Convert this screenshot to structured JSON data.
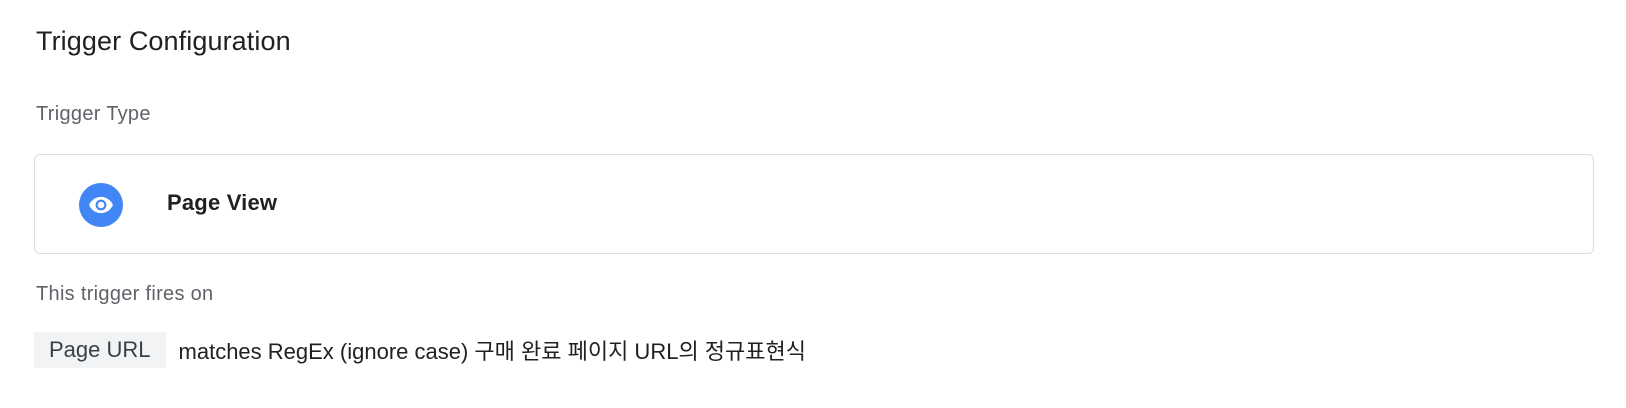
{
  "section": {
    "title": "Trigger Configuration"
  },
  "trigger_type": {
    "label": "Trigger Type",
    "name": "Page View",
    "icon": "eye-icon",
    "icon_color": "#4285f4"
  },
  "firing": {
    "label": "This trigger fires on",
    "variable": "Page URL",
    "operator_value": "matches RegEx (ignore case) 구매 완료 페이지 URL의 정규표현식"
  }
}
